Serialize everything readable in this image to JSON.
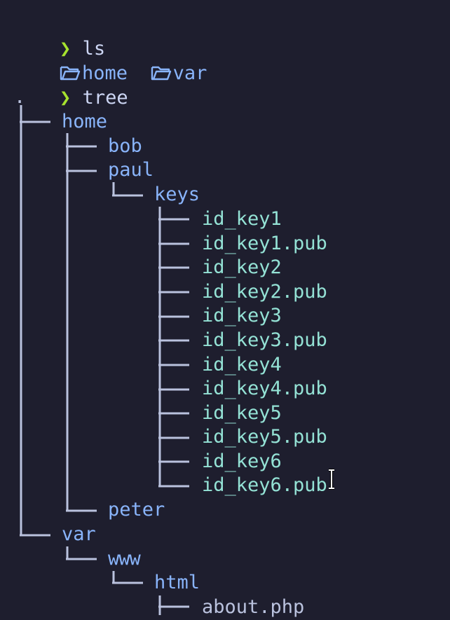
{
  "prompt_symbol": "❯",
  "commands": {
    "ls": "ls",
    "tree": "tree"
  },
  "ls_output": [
    {
      "icon": "folder-icon",
      "name": "home"
    },
    {
      "icon": "folder-icon",
      "name": "var"
    }
  ],
  "tree": {
    "root": ".",
    "home": "home",
    "bob": "bob",
    "paul": "paul",
    "keys": "keys",
    "key_files": [
      "id_key1",
      "id_key1.pub",
      "id_key2",
      "id_key2.pub",
      "id_key3",
      "id_key3.pub",
      "id_key4",
      "id_key4.pub",
      "id_key5",
      "id_key5.pub",
      "id_key6",
      "id_key6.pub"
    ],
    "peter": "peter",
    "var": "var",
    "www": "www",
    "html": "html",
    "about": "about.php"
  },
  "colors": {
    "background": "#1e1e2e",
    "prompt": "#a6e22e",
    "directory": "#89b4fa",
    "file": "#94e2d5",
    "tree_lines": "#bac2de"
  }
}
